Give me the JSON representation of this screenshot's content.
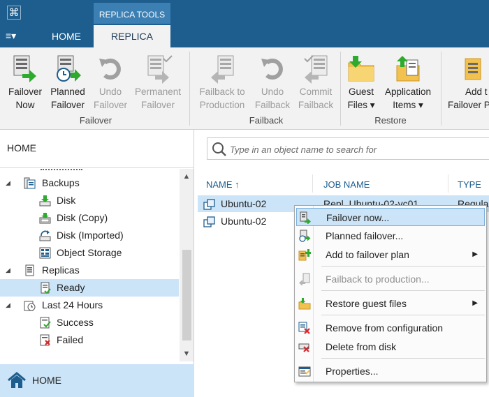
{
  "app": {
    "icon": "veeam-logo-icon",
    "context_tab_label": "REPLICA TOOLS",
    "menu_button": "≡▾"
  },
  "tabs": [
    {
      "label": "HOME",
      "active": false
    },
    {
      "label": "REPLICA",
      "active": true
    }
  ],
  "ribbon": {
    "groups": [
      {
        "label": "Failover",
        "buttons": [
          {
            "line1": "Failover",
            "line2": "Now",
            "enabled": true,
            "icon": "failover-now-icon"
          },
          {
            "line1": "Planned",
            "line2": "Failover",
            "enabled": true,
            "icon": "planned-failover-icon"
          },
          {
            "line1": "Undo",
            "line2": "Failover",
            "enabled": false,
            "icon": "undo-icon"
          },
          {
            "line1": "Permanent",
            "line2": "Failover",
            "enabled": false,
            "icon": "permanent-failover-icon"
          }
        ]
      },
      {
        "label": "Failback",
        "buttons": [
          {
            "line1": "Failback to",
            "line2": "Production",
            "enabled": false,
            "icon": "failback-icon"
          },
          {
            "line1": "Undo",
            "line2": "Failback",
            "enabled": false,
            "icon": "undo-icon"
          },
          {
            "line1": "Commit",
            "line2": "Failback",
            "enabled": false,
            "icon": "commit-failback-icon"
          }
        ]
      },
      {
        "label": "Restore",
        "buttons": [
          {
            "line1": "Guest",
            "line2": "Files ▾",
            "enabled": true,
            "icon": "guest-files-icon"
          },
          {
            "line1": "Application",
            "line2": "Items ▾",
            "enabled": true,
            "icon": "application-items-icon"
          }
        ]
      },
      {
        "label": "",
        "buttons": [
          {
            "line1": "Add t",
            "line2": "Failover P",
            "enabled": true,
            "icon": "add-to-plan-icon"
          }
        ]
      }
    ]
  },
  "nav": {
    "title": "HOME",
    "tree": [
      {
        "label": "Backups",
        "level": 0,
        "expanded": true,
        "icon": "backups-icon"
      },
      {
        "label": "Disk",
        "level": 1,
        "icon": "disk-icon"
      },
      {
        "label": "Disk (Copy)",
        "level": 1,
        "icon": "disk-copy-icon"
      },
      {
        "label": "Disk (Imported)",
        "level": 1,
        "icon": "disk-imported-icon"
      },
      {
        "label": "Object Storage",
        "level": 1,
        "icon": "object-storage-icon"
      },
      {
        "label": "Replicas",
        "level": 0,
        "expanded": true,
        "icon": "replicas-icon"
      },
      {
        "label": "Ready",
        "level": 1,
        "selected": true,
        "icon": "ready-icon"
      },
      {
        "label": "Last 24 Hours",
        "level": 0,
        "expanded": true,
        "icon": "last-24-hours-icon"
      },
      {
        "label": "Success",
        "level": 1,
        "icon": "success-icon"
      },
      {
        "label": "Failed",
        "level": 1,
        "icon": "failed-icon"
      }
    ],
    "home_label": "HOME"
  },
  "main": {
    "search_placeholder": "Type in an object name to search for",
    "columns": [
      {
        "label": "NAME ↑"
      },
      {
        "label": "JOB NAME"
      },
      {
        "label": "TYPE"
      }
    ],
    "rows": [
      {
        "name": "Ubuntu-02",
        "job": "Repl_Ubuntu-02-vc01",
        "type": "Regula",
        "selected": true
      },
      {
        "name": "Ubuntu-02",
        "job": "",
        "type": "",
        "selected": false
      }
    ]
  },
  "context_menu": {
    "items": [
      {
        "label": "Failover now...",
        "icon": "failover-now-icon",
        "highlight": true
      },
      {
        "label": "Planned failover...",
        "icon": "planned-failover-icon"
      },
      {
        "label": "Add to failover plan",
        "icon": "add-to-plan-icon",
        "submenu": true
      },
      {
        "label": "Failback to production...",
        "icon": "failback-icon",
        "disabled": true
      },
      {
        "label": "Restore guest files",
        "icon": "restore-guest-files-icon",
        "submenu": true
      },
      {
        "label": "Remove from configuration",
        "icon": "remove-icon"
      },
      {
        "label": "Delete from disk",
        "icon": "delete-icon"
      },
      {
        "label": "Properties...",
        "icon": "properties-icon"
      }
    ]
  },
  "colors": {
    "titlebar": "#1e5e8e",
    "selection": "#cce4f7",
    "accent_green": "#2eaa2e"
  }
}
